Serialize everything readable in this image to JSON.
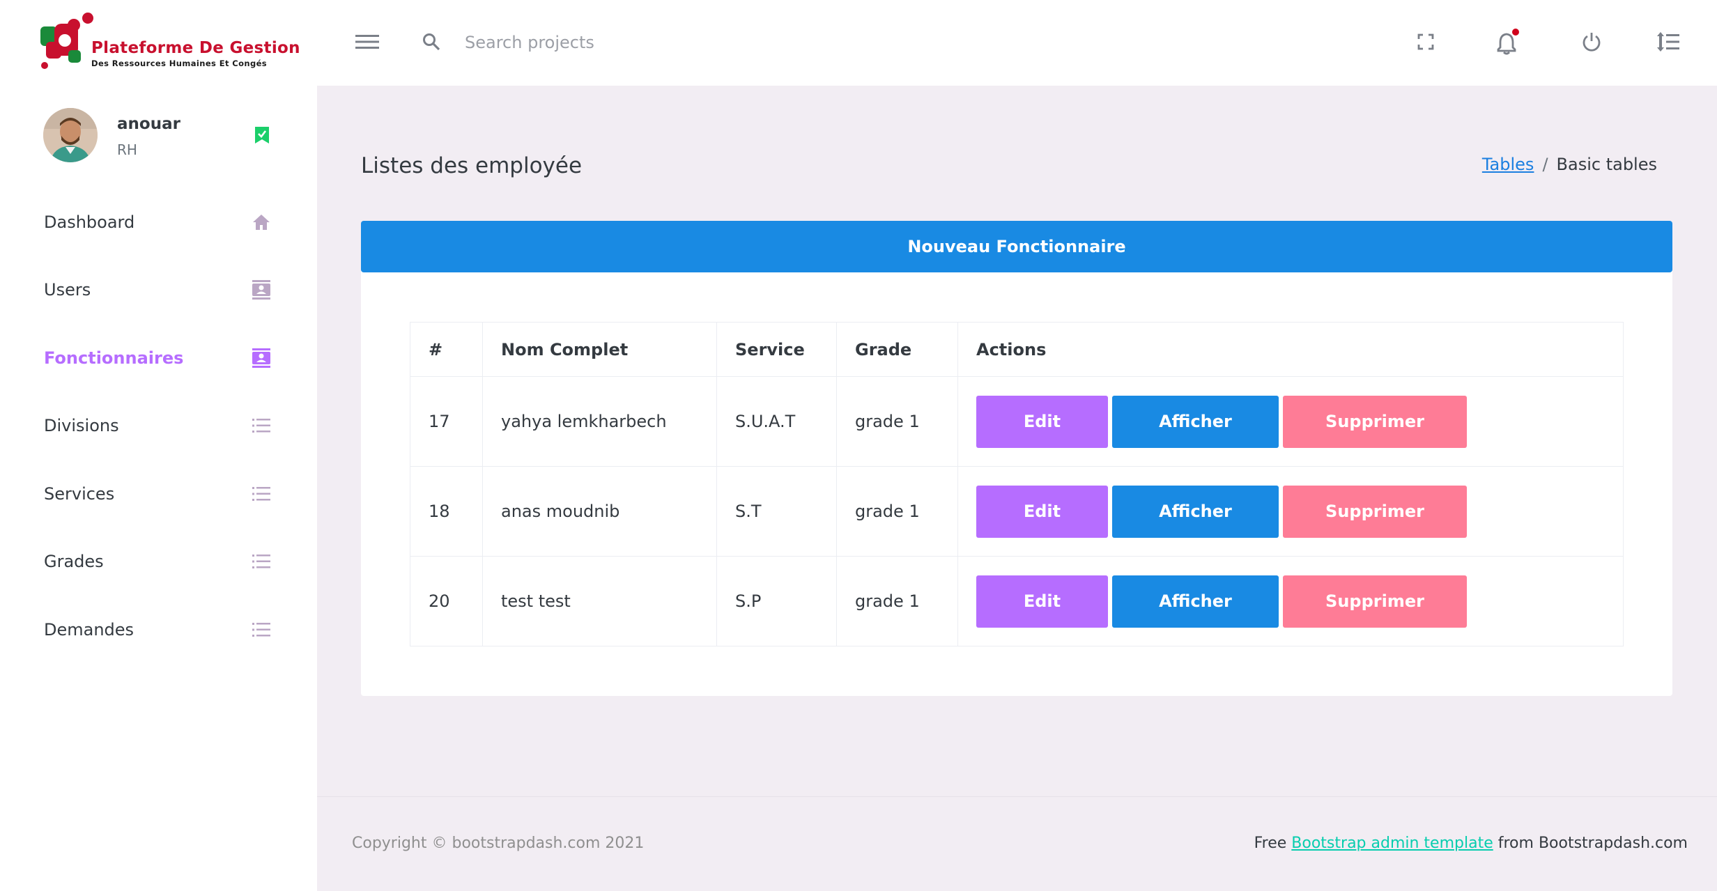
{
  "brand": {
    "title": "Plateforme De Gestion",
    "subtitle": "Des Ressources Humaines Et Congés"
  },
  "profile": {
    "name": "anouar",
    "role": "RH"
  },
  "sidebar": {
    "items": [
      {
        "label": "Dashboard",
        "icon": "home-icon"
      },
      {
        "label": "Users",
        "icon": "contacts-icon"
      },
      {
        "label": "Fonctionnaires",
        "icon": "contacts-icon",
        "active": true
      },
      {
        "label": "Divisions",
        "icon": "list-icon"
      },
      {
        "label": "Services",
        "icon": "list-icon"
      },
      {
        "label": "Grades",
        "icon": "list-icon"
      },
      {
        "label": "Demandes",
        "icon": "list-icon"
      }
    ]
  },
  "topbar": {
    "search_placeholder": "Search projects",
    "icons": [
      "menu-icon",
      "search-icon",
      "fullscreen-icon",
      "bell-icon",
      "power-icon",
      "format-line-spacing-icon"
    ]
  },
  "page": {
    "title": "Listes des employée",
    "breadcrumb": {
      "link": "Tables",
      "separator": "/",
      "current": "Basic tables"
    }
  },
  "card": {
    "new_button": "Nouveau Fonctionnaire"
  },
  "table": {
    "headers": [
      "#",
      "Nom Complet",
      "Service",
      "Grade",
      "Actions"
    ],
    "rows": [
      {
        "id": "17",
        "name": "yahya lemkharbech",
        "service": "S.U.A.T",
        "grade": "grade 1"
      },
      {
        "id": "18",
        "name": "anas moudnib",
        "service": "S.T",
        "grade": "grade 1"
      },
      {
        "id": "20",
        "name": "test test",
        "service": "S.P",
        "grade": "grade 1"
      }
    ],
    "actions": {
      "edit": "Edit",
      "show": "Afficher",
      "delete": "Supprimer"
    }
  },
  "footer": {
    "copyright": "Copyright © bootstrapdash.com 2021",
    "prefix": "Free",
    "link": "Bootstrap admin template",
    "suffix": "from Bootstrapdash.com"
  },
  "colors": {
    "accent_purple": "#b66dff",
    "primary_blue": "#198ae3",
    "danger_pink": "#fe7c96",
    "badge_green": "#1bcf6a",
    "notification_red": "#d0021b",
    "footer_link": "#07cdae"
  }
}
